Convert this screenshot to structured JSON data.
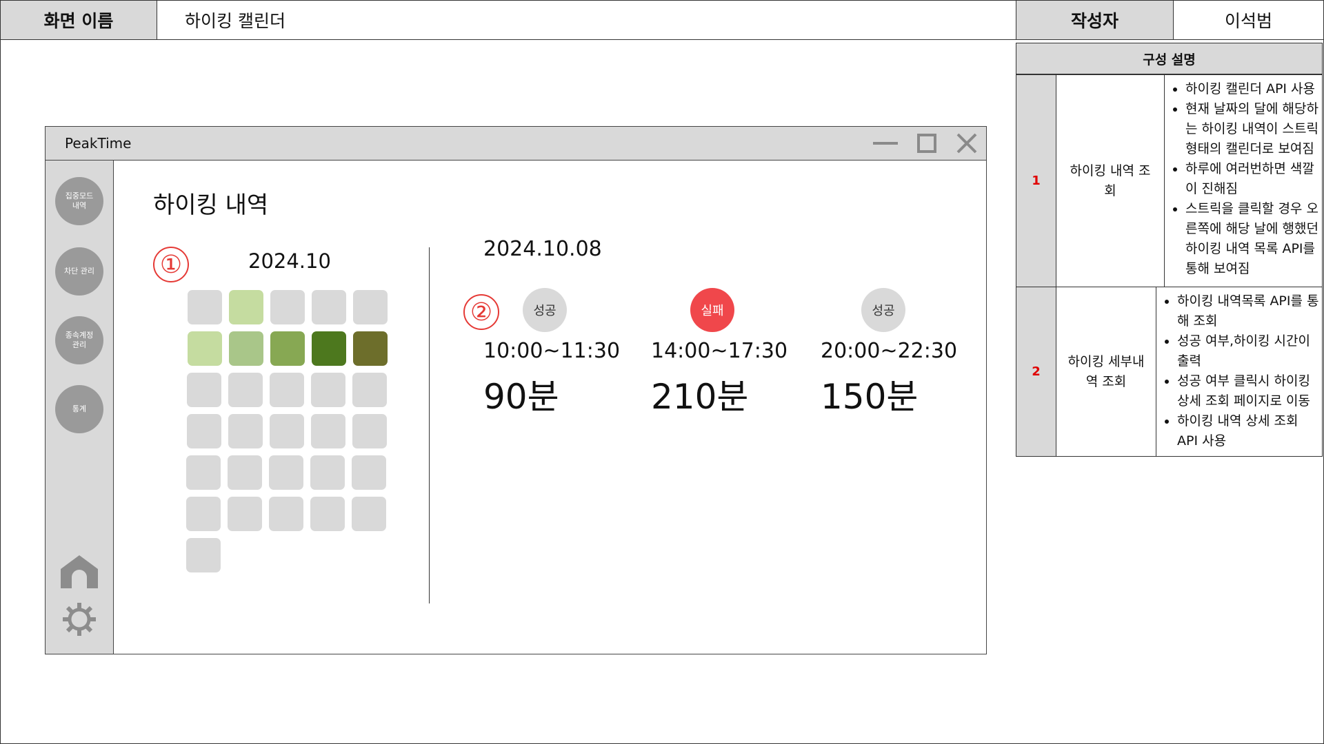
{
  "header": {
    "screen_name_label": "화면 이름",
    "screen_name_value": "하이킹 캘린더",
    "author_label": "작성자",
    "author_value": "이석범"
  },
  "description": {
    "title": "구성 설명",
    "rows": [
      {
        "num": "1",
        "name": "하이킹 내역 조회",
        "items": [
          "하이킹 캘린더 API 사용",
          "현재 날짜의 달에 해당하는 하이킹 내역이 스트릭 형태의 캘린더로 보여짐",
          "하루에 여러번하면 색깔이 진해짐",
          "스트릭을 클릭할 경우 오른쪽에 해당 날에 행했던 하이킹 내역 목록 API를 통해 보여짐"
        ]
      },
      {
        "num": "2",
        "name": "하이킹 세부내역 조회",
        "items": [
          "하이킹 내역목록 API를 통해 조회",
          "성공 여부,하이킹 시간이 출력",
          "성공 여부 클릭시 하이킹 상세 조회 페이지로 이동",
          "하이킹 내역 상세 조회 API 사용"
        ]
      }
    ]
  },
  "window": {
    "app_title": "PeakTime",
    "controls": [
      "minimize-icon",
      "maximize-icon",
      "close-icon"
    ]
  },
  "sidebar": {
    "items": [
      {
        "label": "집중모드\n내역"
      },
      {
        "label": "차단 관리"
      },
      {
        "label": "종속계정\n관리"
      },
      {
        "label": "통계"
      }
    ],
    "bottom_icons": [
      "home-icon",
      "gear-icon"
    ]
  },
  "main": {
    "page_title": "하이킹 내역",
    "markers": [
      "①",
      "②"
    ],
    "calendar": {
      "month": "2024.10",
      "levels": [
        0,
        1,
        0,
        0,
        0,
        1,
        2,
        3,
        4,
        5,
        0,
        0,
        0,
        0,
        0,
        0,
        0,
        0,
        0,
        0,
        0,
        0,
        0,
        0,
        0,
        0,
        0,
        0,
        0,
        0,
        0
      ],
      "level_colors": [
        "#d9d9d9",
        "#c5dca0",
        "#a9c689",
        "#87a853",
        "#4d781e",
        "#6d6e2b"
      ]
    },
    "detail": {
      "date": "2024.10.08",
      "sessions": [
        {
          "status": "성공",
          "status_color": "#d9d9d9",
          "status_text_color": "#333333",
          "time": "10:00~11:30",
          "duration": "90분"
        },
        {
          "status": "실패",
          "status_color": "#f0474b",
          "status_text_color": "#ffffff",
          "time": "14:00~17:30",
          "duration": "210분"
        },
        {
          "status": "성공",
          "status_color": "#d9d9d9",
          "status_text_color": "#333333",
          "time": "20:00~22:30",
          "duration": "150분"
        }
      ]
    }
  }
}
